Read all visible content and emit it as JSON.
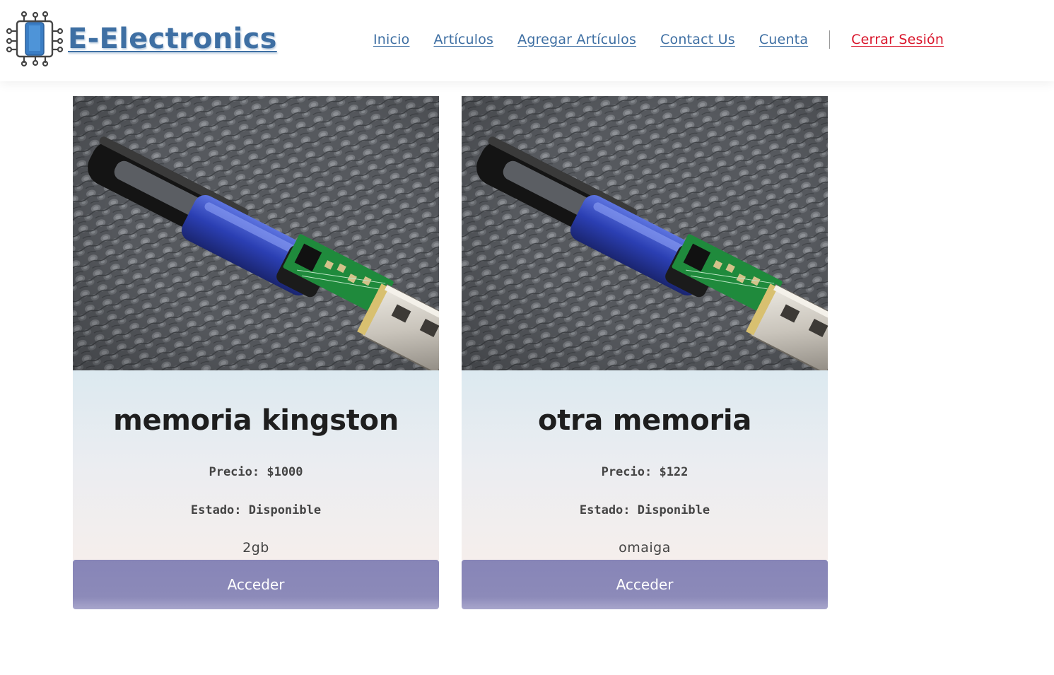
{
  "header": {
    "brand": "E-Electronics",
    "logo_icon": "circuit-phone-icon",
    "nav": [
      {
        "label": "Inicio"
      },
      {
        "label": "Artículos"
      },
      {
        "label": "Agregar Artículos"
      },
      {
        "label": "Contact Us"
      },
      {
        "label": "Cuenta"
      }
    ],
    "logout_label": "Cerrar Sesión"
  },
  "products": [
    {
      "name": "memoria kingston",
      "price": "Precio: $1000",
      "status": "Estado: Disponible",
      "description": "2gb",
      "button_label": "Acceder",
      "image_icon": "usb-drive-photo"
    },
    {
      "name": "otra memoria",
      "price": "Precio: $122",
      "status": "Estado: Disponible",
      "description": "omaiga",
      "button_label": "Acceder",
      "image_icon": "usb-drive-photo"
    }
  ],
  "colors": {
    "brand": "#3e6fa3",
    "logout": "#d9142a",
    "button": "#8785b7"
  }
}
